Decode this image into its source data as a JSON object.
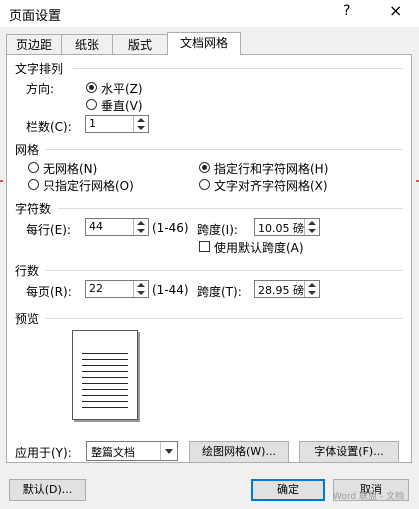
{
  "dialog": {
    "title": "页面设置",
    "help": "?",
    "close": "×"
  },
  "tabs": [
    "页边距",
    "纸张",
    "版式",
    "文档网格"
  ],
  "text_direction": {
    "section": "文字排列",
    "direction_label": "方向:",
    "horizontal": "水平(Z)",
    "vertical": "垂直(V)",
    "columns_label": "栏数(C):",
    "columns_value": "1"
  },
  "grid": {
    "section": "网格",
    "no_grid": "无网格(N)",
    "line_only": "只指定行网格(O)",
    "line_and_char": "指定行和字符网格(H)",
    "snap_chars": "文字对齐字符网格(X)"
  },
  "characters": {
    "section": "字符数",
    "per_line_label": "每行(E):",
    "per_line_value": "44",
    "per_line_range": "(1-46)",
    "pitch_label": "跨度(I):",
    "pitch_value": "10.05 磅",
    "use_default_pitch": "使用默认跨度(A)"
  },
  "lines": {
    "section": "行数",
    "per_page_label": "每页(R):",
    "per_page_value": "22",
    "per_page_range": "(1-44)",
    "pitch_label": "跨度(T):",
    "pitch_value": "28.95 磅"
  },
  "preview": {
    "section": "预览"
  },
  "apply": {
    "label": "应用于(Y):",
    "value": "整篇文档"
  },
  "buttons": {
    "draw_grid": "绘图网格(W)...",
    "font_settings": "字体设置(F)...",
    "default": "默认(D)...",
    "ok": "确定",
    "cancel": "取消"
  },
  "watermark": "Word 联盟 - 文档"
}
